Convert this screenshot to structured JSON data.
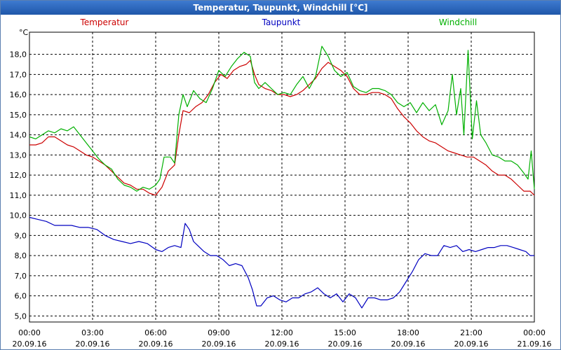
{
  "window_title": "Temperatur, Taupunkt, Windchill [°C]",
  "chart_data": {
    "type": "line",
    "title": "Temperatur, Taupunkt, Windchill [°C]",
    "ylabel": "°C",
    "xlabel": "",
    "ylim": [
      4.7,
      19.1
    ],
    "y_ticks": [
      "5,0",
      "6,0",
      "7,0",
      "8,0",
      "9,0",
      "10,0",
      "11,0",
      "12,0",
      "13,0",
      "14,0",
      "15,0",
      "16,0",
      "17,0",
      "18,0"
    ],
    "x_ticks": [
      {
        "time": "00:00",
        "date": "20.09.16"
      },
      {
        "time": "03:00",
        "date": "20.09.16"
      },
      {
        "time": "06:00",
        "date": "20.09.16"
      },
      {
        "time": "09:00",
        "date": "20.09.16"
      },
      {
        "time": "12:00",
        "date": "20.09.16"
      },
      {
        "time": "15:00",
        "date": "20.09.16"
      },
      {
        "time": "18:00",
        "date": "20.09.16"
      },
      {
        "time": "21:00",
        "date": "20.09.16"
      },
      {
        "time": "00:00",
        "date": "21.09.16"
      }
    ],
    "x_unit": "hours since 20.09.16 00:00",
    "grid": true,
    "legend_position": "top",
    "series": [
      {
        "name": "Temperatur",
        "color": "#cc0000",
        "points": [
          [
            0,
            13.5
          ],
          [
            0.3,
            13.5
          ],
          [
            0.6,
            13.6
          ],
          [
            0.9,
            13.9
          ],
          [
            1.2,
            13.9
          ],
          [
            1.5,
            13.7
          ],
          [
            1.8,
            13.5
          ],
          [
            2.1,
            13.4
          ],
          [
            2.4,
            13.2
          ],
          [
            2.7,
            13.0
          ],
          [
            3.0,
            12.9
          ],
          [
            3.3,
            12.7
          ],
          [
            3.6,
            12.5
          ],
          [
            3.9,
            12.2
          ],
          [
            4.2,
            11.9
          ],
          [
            4.5,
            11.6
          ],
          [
            4.8,
            11.5
          ],
          [
            5.1,
            11.3
          ],
          [
            5.4,
            11.3
          ],
          [
            5.7,
            11.1
          ],
          [
            6.0,
            11.0
          ],
          [
            6.3,
            11.4
          ],
          [
            6.6,
            12.2
          ],
          [
            6.9,
            12.5
          ],
          [
            7.1,
            14.0
          ],
          [
            7.3,
            15.2
          ],
          [
            7.6,
            15.1
          ],
          [
            7.9,
            15.4
          ],
          [
            8.2,
            15.6
          ],
          [
            8.5,
            16.0
          ],
          [
            8.8,
            16.6
          ],
          [
            9.1,
            17.0
          ],
          [
            9.4,
            16.8
          ],
          [
            9.7,
            17.2
          ],
          [
            10.0,
            17.4
          ],
          [
            10.3,
            17.5
          ],
          [
            10.5,
            17.7
          ],
          [
            10.7,
            17.0
          ],
          [
            10.9,
            16.5
          ],
          [
            11.2,
            16.3
          ],
          [
            11.5,
            16.2
          ],
          [
            11.8,
            16.0
          ],
          [
            12.1,
            16.0
          ],
          [
            12.4,
            15.9
          ],
          [
            12.7,
            16.0
          ],
          [
            13.0,
            16.2
          ],
          [
            13.3,
            16.5
          ],
          [
            13.6,
            16.8
          ],
          [
            13.9,
            17.3
          ],
          [
            14.2,
            17.6
          ],
          [
            14.5,
            17.4
          ],
          [
            14.8,
            17.2
          ],
          [
            15.1,
            16.9
          ],
          [
            15.4,
            16.3
          ],
          [
            15.7,
            16.0
          ],
          [
            16.0,
            16.0
          ],
          [
            16.3,
            16.1
          ],
          [
            16.6,
            16.1
          ],
          [
            16.9,
            16.0
          ],
          [
            17.2,
            15.8
          ],
          [
            17.5,
            15.3
          ],
          [
            17.8,
            14.9
          ],
          [
            18.1,
            14.6
          ],
          [
            18.4,
            14.2
          ],
          [
            18.7,
            13.9
          ],
          [
            19.0,
            13.7
          ],
          [
            19.3,
            13.6
          ],
          [
            19.6,
            13.4
          ],
          [
            19.9,
            13.2
          ],
          [
            20.2,
            13.1
          ],
          [
            20.5,
            13.0
          ],
          [
            20.8,
            12.9
          ],
          [
            21.1,
            12.9
          ],
          [
            21.4,
            12.7
          ],
          [
            21.7,
            12.5
          ],
          [
            22.0,
            12.2
          ],
          [
            22.3,
            12.0
          ],
          [
            22.6,
            12.0
          ],
          [
            22.9,
            11.8
          ],
          [
            23.2,
            11.5
          ],
          [
            23.5,
            11.2
          ],
          [
            23.8,
            11.2
          ],
          [
            24.0,
            11.0
          ]
        ]
      },
      {
        "name": "Taupunkt",
        "color": "#0000c0",
        "points": [
          [
            0,
            9.9
          ],
          [
            0.4,
            9.8
          ],
          [
            0.8,
            9.7
          ],
          [
            1.2,
            9.5
          ],
          [
            1.6,
            9.5
          ],
          [
            2.0,
            9.5
          ],
          [
            2.4,
            9.4
          ],
          [
            2.8,
            9.4
          ],
          [
            3.2,
            9.3
          ],
          [
            3.6,
            9.0
          ],
          [
            4.0,
            8.8
          ],
          [
            4.4,
            8.7
          ],
          [
            4.8,
            8.6
          ],
          [
            5.2,
            8.7
          ],
          [
            5.6,
            8.6
          ],
          [
            6.0,
            8.3
          ],
          [
            6.3,
            8.2
          ],
          [
            6.6,
            8.4
          ],
          [
            6.9,
            8.5
          ],
          [
            7.2,
            8.4
          ],
          [
            7.4,
            9.6
          ],
          [
            7.6,
            9.3
          ],
          [
            7.8,
            8.7
          ],
          [
            8.0,
            8.5
          ],
          [
            8.3,
            8.2
          ],
          [
            8.6,
            8.0
          ],
          [
            8.9,
            8.0
          ],
          [
            9.2,
            7.8
          ],
          [
            9.5,
            7.5
          ],
          [
            9.8,
            7.6
          ],
          [
            10.1,
            7.5
          ],
          [
            10.4,
            6.9
          ],
          [
            10.6,
            6.3
          ],
          [
            10.8,
            5.5
          ],
          [
            11.0,
            5.5
          ],
          [
            11.3,
            5.9
          ],
          [
            11.6,
            6.0
          ],
          [
            11.9,
            5.8
          ],
          [
            12.2,
            5.7
          ],
          [
            12.5,
            5.9
          ],
          [
            12.8,
            5.9
          ],
          [
            13.1,
            6.1
          ],
          [
            13.4,
            6.2
          ],
          [
            13.7,
            6.4
          ],
          [
            14.0,
            6.1
          ],
          [
            14.3,
            5.9
          ],
          [
            14.6,
            6.1
          ],
          [
            14.9,
            5.7
          ],
          [
            15.2,
            6.1
          ],
          [
            15.5,
            5.9
          ],
          [
            15.8,
            5.4
          ],
          [
            16.1,
            5.9
          ],
          [
            16.4,
            5.9
          ],
          [
            16.7,
            5.8
          ],
          [
            17.0,
            5.8
          ],
          [
            17.3,
            5.9
          ],
          [
            17.6,
            6.2
          ],
          [
            17.9,
            6.7
          ],
          [
            18.2,
            7.2
          ],
          [
            18.5,
            7.8
          ],
          [
            18.8,
            8.1
          ],
          [
            19.1,
            8.0
          ],
          [
            19.4,
            8.0
          ],
          [
            19.7,
            8.5
          ],
          [
            20.0,
            8.4
          ],
          [
            20.3,
            8.5
          ],
          [
            20.6,
            8.2
          ],
          [
            20.9,
            8.3
          ],
          [
            21.2,
            8.2
          ],
          [
            21.5,
            8.3
          ],
          [
            21.8,
            8.4
          ],
          [
            22.1,
            8.4
          ],
          [
            22.4,
            8.5
          ],
          [
            22.7,
            8.5
          ],
          [
            23.0,
            8.4
          ],
          [
            23.3,
            8.3
          ],
          [
            23.6,
            8.2
          ],
          [
            23.8,
            8.0
          ],
          [
            24.0,
            8.0
          ]
        ]
      },
      {
        "name": "Windchill",
        "color": "#00b000",
        "points": [
          [
            0,
            13.9
          ],
          [
            0.3,
            13.8
          ],
          [
            0.6,
            14.0
          ],
          [
            0.9,
            14.2
          ],
          [
            1.2,
            14.1
          ],
          [
            1.5,
            14.3
          ],
          [
            1.8,
            14.2
          ],
          [
            2.1,
            14.4
          ],
          [
            2.4,
            14.0
          ],
          [
            2.7,
            13.6
          ],
          [
            3.0,
            13.2
          ],
          [
            3.3,
            12.8
          ],
          [
            3.6,
            12.5
          ],
          [
            3.9,
            12.3
          ],
          [
            4.2,
            11.8
          ],
          [
            4.5,
            11.5
          ],
          [
            4.8,
            11.4
          ],
          [
            5.1,
            11.2
          ],
          [
            5.4,
            11.4
          ],
          [
            5.7,
            11.3
          ],
          [
            6.0,
            11.5
          ],
          [
            6.2,
            11.8
          ],
          [
            6.4,
            12.9
          ],
          [
            6.7,
            12.9
          ],
          [
            6.9,
            12.6
          ],
          [
            7.1,
            15.0
          ],
          [
            7.3,
            16.0
          ],
          [
            7.5,
            15.4
          ],
          [
            7.8,
            16.2
          ],
          [
            8.1,
            15.8
          ],
          [
            8.4,
            15.6
          ],
          [
            8.7,
            16.3
          ],
          [
            9.0,
            17.2
          ],
          [
            9.3,
            16.9
          ],
          [
            9.6,
            17.4
          ],
          [
            9.9,
            17.8
          ],
          [
            10.2,
            18.1
          ],
          [
            10.5,
            17.9
          ],
          [
            10.7,
            16.6
          ],
          [
            10.9,
            16.3
          ],
          [
            11.2,
            16.6
          ],
          [
            11.5,
            16.3
          ],
          [
            11.8,
            16.0
          ],
          [
            12.1,
            16.1
          ],
          [
            12.4,
            16.0
          ],
          [
            12.7,
            16.5
          ],
          [
            13.0,
            16.9
          ],
          [
            13.3,
            16.3
          ],
          [
            13.6,
            16.9
          ],
          [
            13.9,
            18.4
          ],
          [
            14.2,
            17.9
          ],
          [
            14.5,
            17.2
          ],
          [
            14.8,
            16.9
          ],
          [
            15.1,
            17.1
          ],
          [
            15.4,
            16.4
          ],
          [
            15.7,
            16.2
          ],
          [
            16.0,
            16.1
          ],
          [
            16.3,
            16.3
          ],
          [
            16.6,
            16.3
          ],
          [
            16.9,
            16.2
          ],
          [
            17.2,
            16.0
          ],
          [
            17.5,
            15.6
          ],
          [
            17.8,
            15.4
          ],
          [
            18.1,
            15.6
          ],
          [
            18.4,
            15.1
          ],
          [
            18.7,
            15.6
          ],
          [
            19.0,
            15.2
          ],
          [
            19.3,
            15.5
          ],
          [
            19.6,
            14.5
          ],
          [
            19.9,
            15.2
          ],
          [
            20.1,
            17.0
          ],
          [
            20.3,
            15.0
          ],
          [
            20.5,
            16.3
          ],
          [
            20.65,
            14.0
          ],
          [
            20.85,
            18.2
          ],
          [
            20.95,
            16.0
          ],
          [
            21.05,
            13.8
          ],
          [
            21.25,
            15.7
          ],
          [
            21.45,
            14.0
          ],
          [
            21.7,
            13.6
          ],
          [
            22.0,
            13.0
          ],
          [
            22.3,
            12.9
          ],
          [
            22.6,
            12.7
          ],
          [
            22.9,
            12.7
          ],
          [
            23.2,
            12.5
          ],
          [
            23.5,
            12.1
          ],
          [
            23.7,
            11.8
          ],
          [
            23.85,
            13.2
          ],
          [
            24.0,
            11.3
          ]
        ]
      }
    ]
  }
}
